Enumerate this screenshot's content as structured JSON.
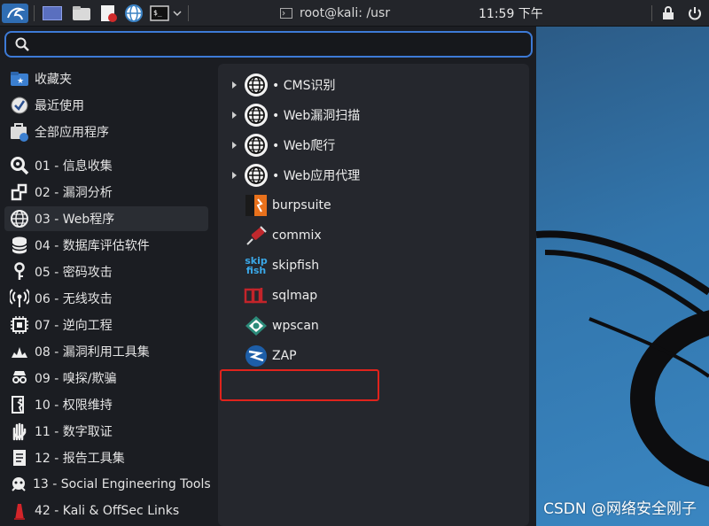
{
  "taskbar": {
    "window_title": "root@kali: /usr",
    "clock": "11:59 下午",
    "icons": [
      "kali-dragon-icon",
      "workspace-icon",
      "file-manager-icon",
      "text-editor-icon",
      "browser-icon",
      "terminal-icon",
      "chevron-down-icon",
      "lock-icon",
      "power-icon"
    ]
  },
  "search": {
    "value": "",
    "placeholder": ""
  },
  "categories": [
    {
      "label": "收藏夹",
      "icon": "favorites-icon"
    },
    {
      "label": "最近使用",
      "icon": "recent-icon"
    },
    {
      "label": "全部应用程序",
      "icon": "all-apps-icon"
    },
    {
      "label": "01 - 信息收集",
      "icon": "info-gathering-icon"
    },
    {
      "label": "02 - 漏洞分析",
      "icon": "vuln-analysis-icon"
    },
    {
      "label": "03 - Web程序",
      "icon": "web-apps-icon",
      "active": true
    },
    {
      "label": "04 - 数据库评估软件",
      "icon": "database-icon"
    },
    {
      "label": "05 - 密码攻击",
      "icon": "password-icon"
    },
    {
      "label": "06 - 无线攻击",
      "icon": "wireless-icon"
    },
    {
      "label": "07 - 逆向工程",
      "icon": "reverse-engineering-icon"
    },
    {
      "label": "08 - 漏洞利用工具集",
      "icon": "exploitation-icon"
    },
    {
      "label": "09 - 嗅探/欺骗",
      "icon": "sniffing-icon"
    },
    {
      "label": "10 - 权限维持",
      "icon": "post-exploitation-icon"
    },
    {
      "label": "11 - 数字取证",
      "icon": "forensics-icon"
    },
    {
      "label": "12 - 报告工具集",
      "icon": "reporting-icon"
    },
    {
      "label": "13 - Social Engineering Tools",
      "icon": "social-engineering-icon"
    },
    {
      "label": "42 - Kali & OffSec Links",
      "icon": "kali-links-icon"
    }
  ],
  "apps": [
    {
      "label": "• CMS识别",
      "icon": "globe-icon",
      "submenu": true
    },
    {
      "label": "• Web漏洞扫描",
      "icon": "globe-icon",
      "submenu": true
    },
    {
      "label": "• Web爬行",
      "icon": "globe-icon",
      "submenu": true
    },
    {
      "label": "• Web应用代理",
      "icon": "globe-icon",
      "submenu": true
    },
    {
      "label": "burpsuite",
      "icon": "burpsuite-icon"
    },
    {
      "label": "commix",
      "icon": "commix-icon"
    },
    {
      "label": "skipfish",
      "icon": "skipfish-icon",
      "icon_text": [
        "skip",
        "fish"
      ]
    },
    {
      "label": "sqlmap",
      "icon": "sqlmap-icon"
    },
    {
      "label": "wpscan",
      "icon": "wpscan-icon"
    },
    {
      "label": "ZAP",
      "icon": "zap-icon",
      "highlighted": true
    }
  ],
  "colors": {
    "accent": "#3d7ad6",
    "highlight": "#e0231c",
    "panel": "#25272d",
    "background": "#1b1d22"
  },
  "watermark": "CSDN @网络安全刚子"
}
